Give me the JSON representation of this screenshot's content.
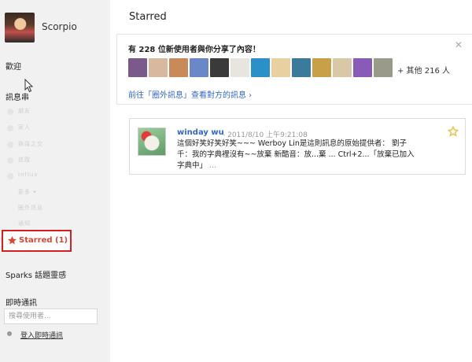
{
  "profile": {
    "name": "Scorpio"
  },
  "nav": {
    "welcome": "歡迎",
    "stream": "訊息串"
  },
  "stream_items": [
    {
      "label": "朋友"
    },
    {
      "label": "家人"
    },
    {
      "label": "熟識之交"
    },
    {
      "label": "追蹤"
    },
    {
      "label": "Influx"
    },
    {
      "label": "更多 ▾"
    },
    {
      "label": "圈外訊息"
    },
    {
      "label": "通知"
    }
  ],
  "starred": {
    "label": "Starred (1)"
  },
  "sparks": {
    "label": "Sparks 話題靈感"
  },
  "chat": {
    "title": "即時通訊",
    "search_placeholder": "搜尋使用者...",
    "login": "登入即時通訊"
  },
  "main": {
    "title": "Starred"
  },
  "suggest": {
    "title": "有 228 位新使用者與你分享了內容！",
    "more": "+ 其他 216 人",
    "link": "前往「圈外訊息」查看對方的訊息 ›",
    "thumb_colors": [
      "#7a5a8a",
      "#d9b8a0",
      "#c98a5a",
      "#6a88c8",
      "#3a3a3a",
      "#e8e4de",
      "#2b8fc8",
      "#e8d0a0",
      "#3a7a9a",
      "#c8a048",
      "#d8c8a8",
      "#8a5ab8",
      "#9a9a8a"
    ]
  },
  "post": {
    "author": "winday wu",
    "meta": "- 2011/8/10 上午9:21:08",
    "body": "這個好笑好笑好笑~~~ Werboy Lin是這則訊息的原始提供者： 劉子千：我的字典裡沒有~~放棄 新酷音：放...棄 ... Ctrl+2...「放棄已加入字典中」",
    "more": "..."
  },
  "colors": {
    "accent_red": "#d21f1f",
    "link_blue": "#3366cc",
    "star_gold": "#e8b62a"
  }
}
